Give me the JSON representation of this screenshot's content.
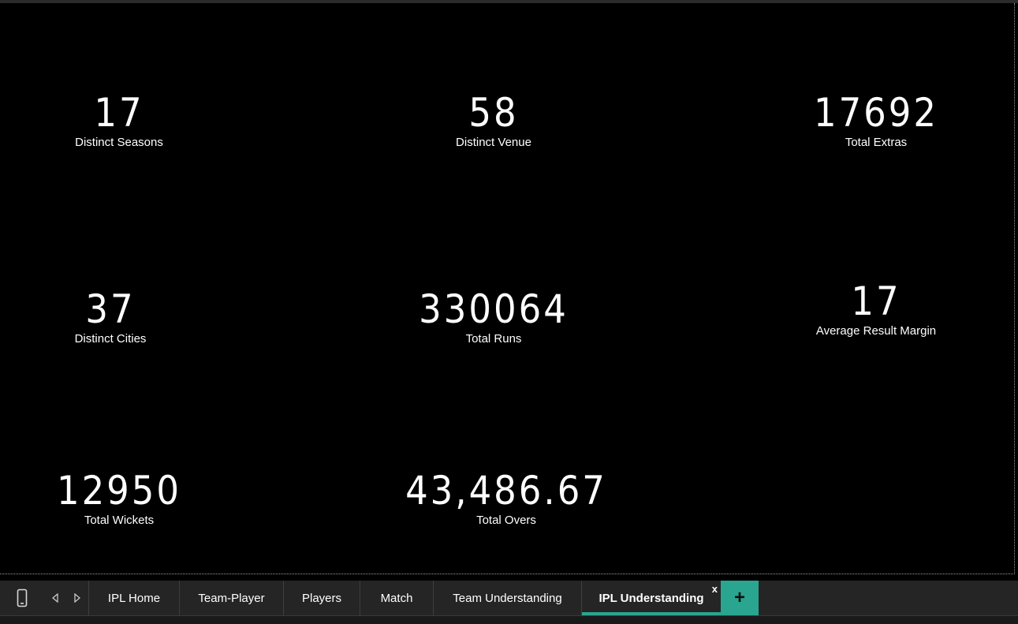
{
  "cards": [
    {
      "value": "17",
      "label": "Distinct Seasons"
    },
    {
      "value": "58",
      "label": "Distinct Venue"
    },
    {
      "value": "17692",
      "label": "Total Extras"
    },
    {
      "value": "37",
      "label": "Distinct Cities"
    },
    {
      "value": "330064",
      "label": "Total Runs"
    },
    {
      "value": "17",
      "label": "Average Result Margin"
    },
    {
      "value": "12950",
      "label": "Total Wickets"
    },
    {
      "value": "43,486.67",
      "label": "Total Overs"
    }
  ],
  "tabs": {
    "items": [
      {
        "label": "IPL Home"
      },
      {
        "label": "Team-Player"
      },
      {
        "label": "Players"
      },
      {
        "label": "Match"
      },
      {
        "label": "Team Understanding"
      },
      {
        "label": "IPL Understanding"
      }
    ],
    "active": "IPL Understanding",
    "close_label": "x",
    "add_label": "+"
  },
  "icons": {
    "mobile": "mobile-layout-icon",
    "prev": "previous-page-icon",
    "next": "next-page-icon",
    "add": "add-page-icon",
    "close": "close-tab-icon"
  },
  "colors": {
    "background": "#000000",
    "text": "#ffffff",
    "accent": "#2aa58f",
    "tabbar": "#252525"
  }
}
